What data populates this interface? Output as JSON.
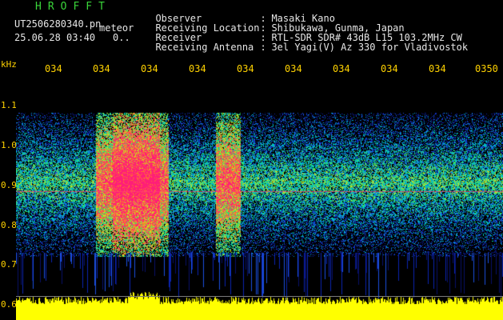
{
  "header": {
    "app_title": "HROFFT",
    "file_name": "UT2506280340.pn",
    "mode_label": "meteor",
    "date_time": "25.06.28 03:40",
    "counter": "0..",
    "info": [
      {
        "key": "Observer",
        "value": "Masaki Kano"
      },
      {
        "key": "Receiving Location",
        "value": "Shibukawa, Gunma, Japan"
      },
      {
        "key": "Receiver",
        "value": "RTL-SDR SDR# 43dB L15 103.2MHz CW"
      },
      {
        "key": "Receiving Antenna",
        "value": "3el Yagi(V) Az 330 for Vladivostok"
      }
    ]
  },
  "axes": {
    "y_unit": "kHz",
    "y_ticks": [
      "1.1",
      "1.0",
      "0.9",
      "0.8",
      "0.7",
      "0.6"
    ],
    "x_ticks": [
      "034",
      "034",
      "034",
      "034",
      "034",
      "034",
      "034",
      "034",
      "034",
      "0350"
    ]
  },
  "colors": {
    "title": "#3ad63a",
    "axis_text": "#ffd200",
    "header_text": "#e6e6e6",
    "background": "#000000",
    "spectrum_low": "#0a1aa0",
    "spectrum_mid": "#00c8c8",
    "spectrum_high": "#ff1e78",
    "baseline": "#ffff00"
  }
}
